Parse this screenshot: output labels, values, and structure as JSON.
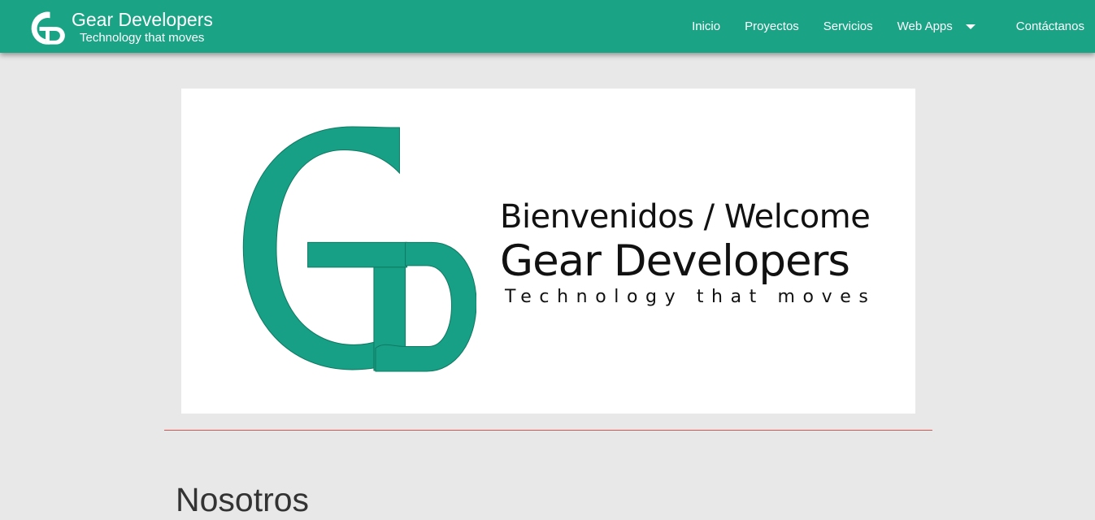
{
  "brand": {
    "title": "Gear Developers",
    "tagline": "Technology that moves",
    "logo_icon": "gd-logo-icon"
  },
  "nav": {
    "items": [
      {
        "label": "Inicio"
      },
      {
        "label": "Proyectos"
      },
      {
        "label": "Servicios"
      },
      {
        "label": "Web Apps",
        "has_dropdown": true
      },
      {
        "label": "Contáctanos"
      }
    ]
  },
  "banner": {
    "welcome": "Bienvenidos / Welcome",
    "title": "Gear Developers",
    "tagline": "Technology that moves"
  },
  "section": {
    "title": "Nosotros"
  },
  "colors": {
    "primary": "#1aa385",
    "banner_logo": "#17a085",
    "background": "#e8e8e8",
    "divider": "#d9534f"
  }
}
